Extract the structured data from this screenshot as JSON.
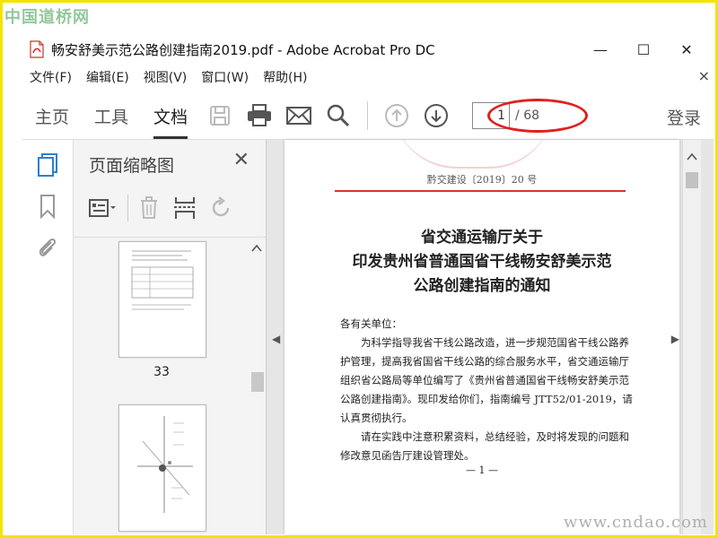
{
  "watermark": {
    "top_left": "中国道桥网",
    "bottom_right": "www.cndao.com"
  },
  "window": {
    "title": "畅安舒美示范公路创建指南2019.pdf - Adobe Acrobat Pro DC",
    "minimize": "—",
    "maximize": "☐",
    "close": "✕"
  },
  "menu": {
    "items": [
      "文件(F)",
      "编辑(E)",
      "视图(V)",
      "窗口(W)",
      "帮助(H)"
    ],
    "close": "×"
  },
  "toolbar": {
    "tabs": [
      "主页",
      "工具",
      "文档"
    ],
    "active_tab": "文档",
    "page_current": "1",
    "page_total": "/ 68",
    "signin": "登录"
  },
  "thumbnail_panel": {
    "title": "页面缩略图",
    "close": "✕",
    "page_label": "33"
  },
  "document": {
    "doc_number": "黔交建设〔2019〕20 号",
    "title_lines": [
      "省交通运输厅关于",
      "印发贵州省普通国省干线畅安舒美示范",
      "公路创建指南的通知"
    ],
    "salutation": "各有关单位：",
    "body": [
      "为科学指导我省干线公路改造，进一步规范国省干线公路养护管理，提高我省国省干线公路的综合服务水平，省交通运输厅组织省公路局等单位编写了《贵州省普通国省干线畅安舒美示范公路创建指南》。现印发给你们，指南编号 JTT52/01-2019，请认真贯彻执行。",
      "请在实践中注意积累资料，总结经验，及时将发现的问题和修改意见函告厅建设管理处。"
    ],
    "page_footer": "— 1 —"
  },
  "colors": {
    "accent_highlight": "#e02020",
    "border_frame": "#f2e400",
    "red_rule": "#d33333"
  }
}
